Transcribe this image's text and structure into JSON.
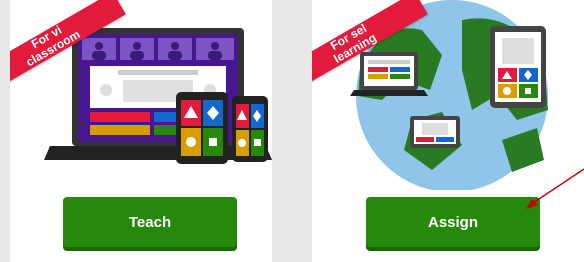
{
  "cards": [
    {
      "ribbon_line1": "For vi",
      "ribbon_line2": "classroom",
      "button_label": "Teach"
    },
    {
      "ribbon_line1": "For sel",
      "ribbon_line2": "learning",
      "button_label": "Assign"
    }
  ],
  "colors": {
    "button_green": "#26890c",
    "ribbon_red": "#e21b3c",
    "answer_red": "#e21b3c",
    "answer_blue": "#1368ce",
    "answer_yellow": "#d89e00",
    "answer_green": "#26890c",
    "laptop_purple": "#46178f",
    "annotation_arrow": "#cc0000"
  }
}
